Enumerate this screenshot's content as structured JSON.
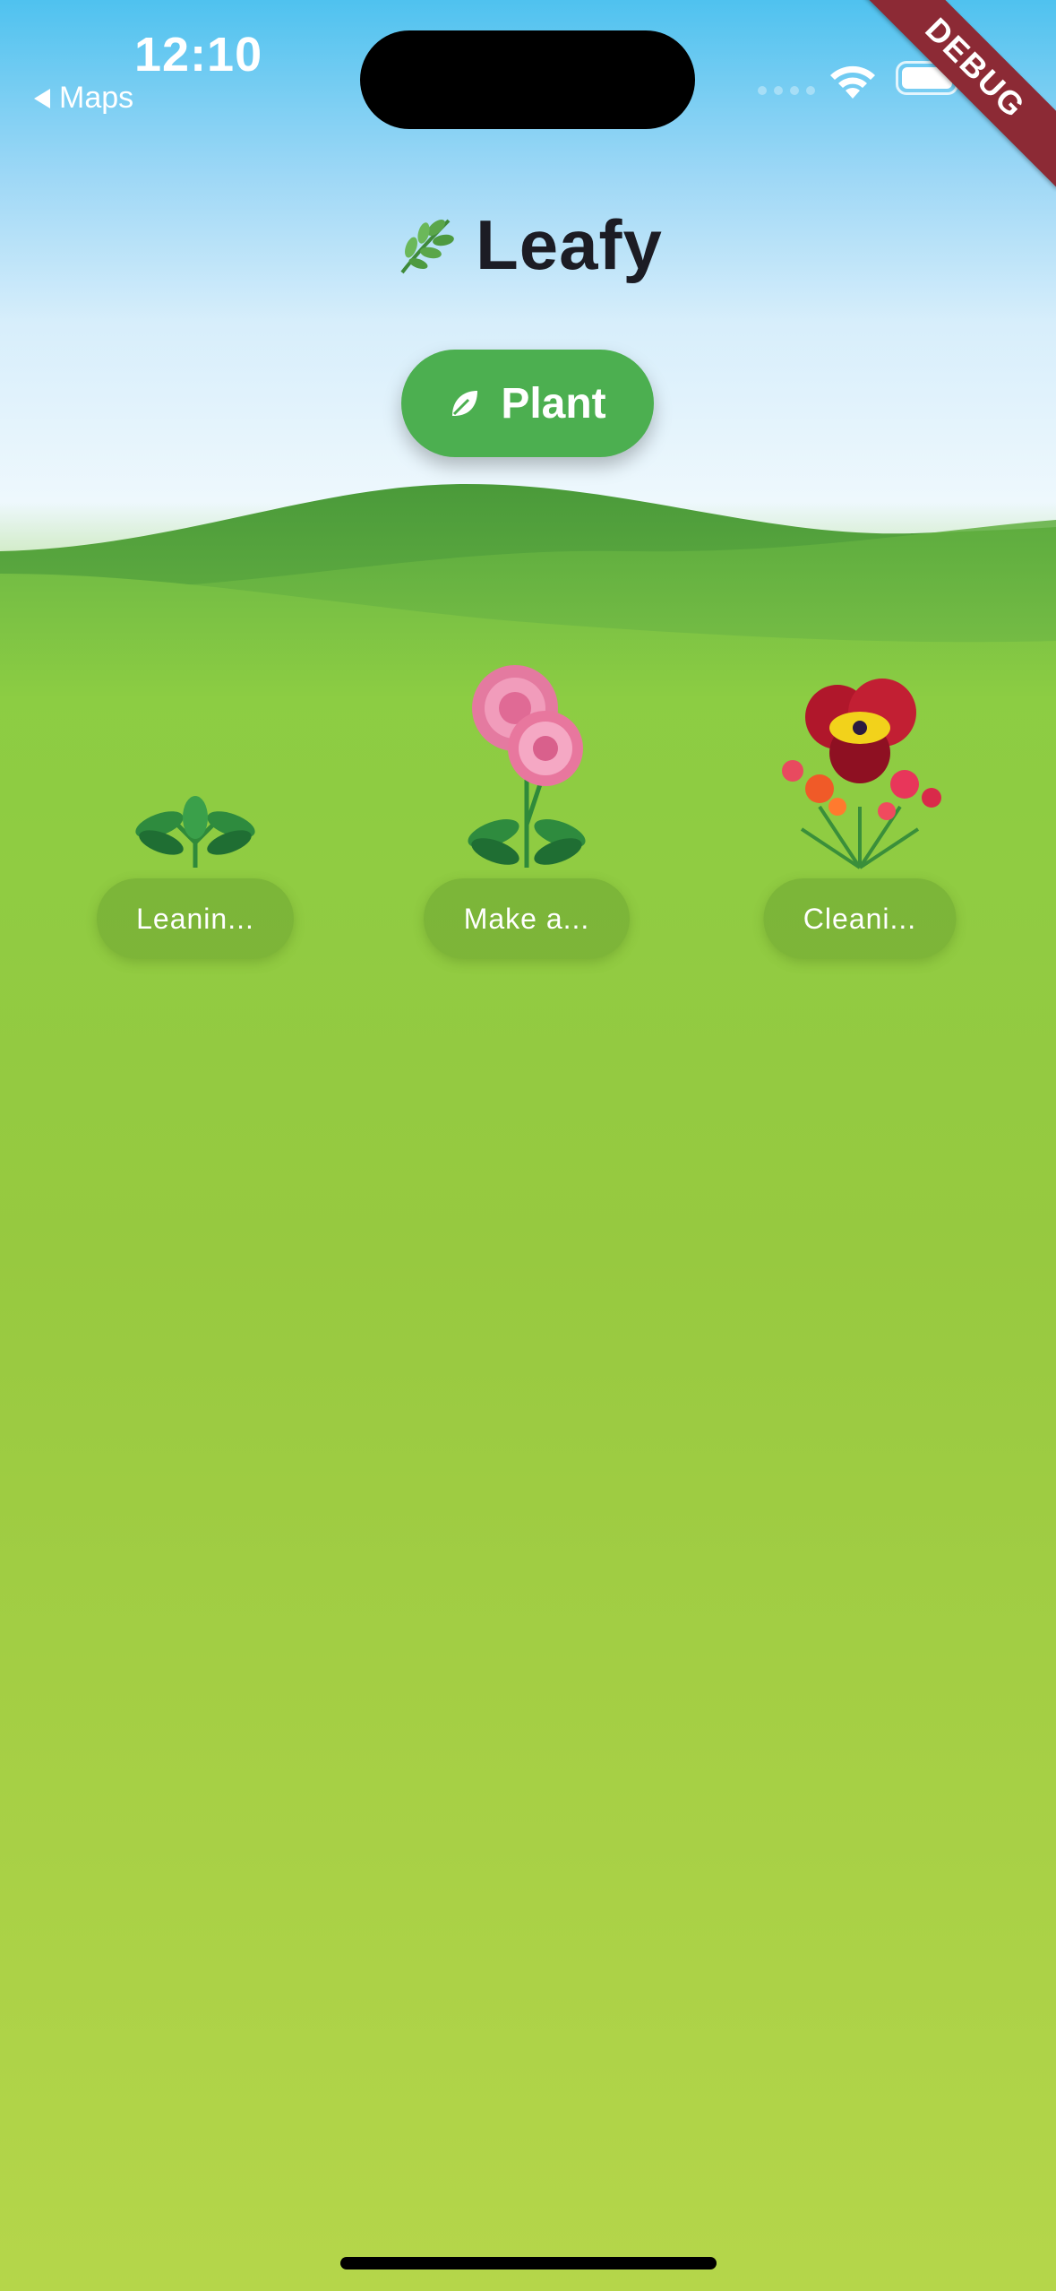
{
  "status_bar": {
    "time": "12:10",
    "back_label": "Maps"
  },
  "debug_banner": "DEBUG",
  "header": {
    "title": "Leafy",
    "title_icon": "herb-icon",
    "plant_button_label": "Plant",
    "plant_button_icon": "leaf-icon"
  },
  "garden": {
    "plants": [
      {
        "label": "Leanin...",
        "icon": "seedling-icon"
      },
      {
        "label": "Make a...",
        "icon": "pink-flower-icon"
      },
      {
        "label": "Cleani...",
        "icon": "flower-bouquet-icon"
      }
    ]
  },
  "colors": {
    "accent": "#4caf50",
    "debug_banner": "#8c2a35",
    "title_text": "#1c1c24"
  }
}
